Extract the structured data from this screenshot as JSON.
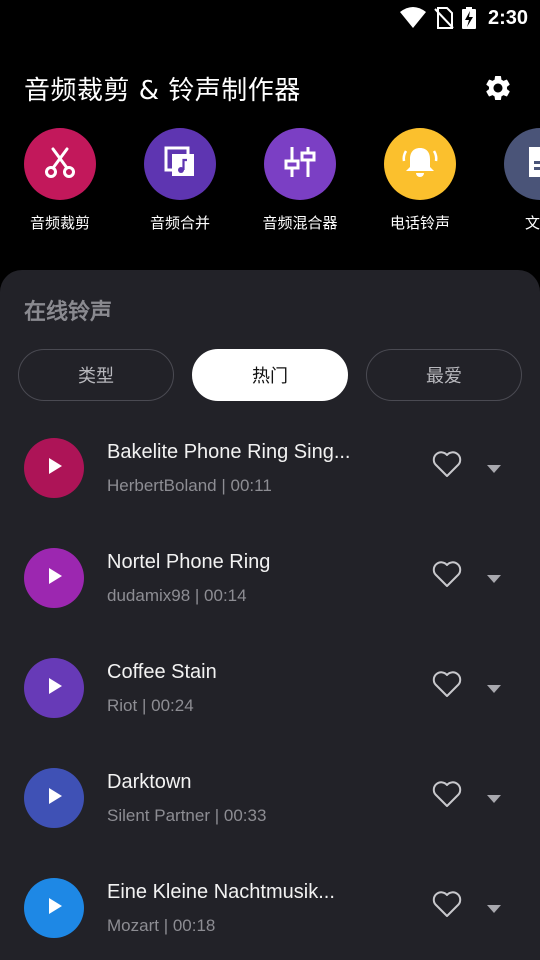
{
  "status_bar": {
    "time": "2:30"
  },
  "header": {
    "title": "音频裁剪 & 铃声制作器"
  },
  "tools": [
    {
      "label": "音频裁剪",
      "color": "#c2185b",
      "icon": "scissors-icon"
    },
    {
      "label": "音频合并",
      "color": "#5e35b1",
      "icon": "merge-icon"
    },
    {
      "label": "音频混合器",
      "color": "#7b3fc4",
      "icon": "mixer-sliders-icon"
    },
    {
      "label": "电话铃声",
      "color": "#fbc02d",
      "icon": "bell-icon"
    },
    {
      "label": "文件",
      "color": "#4a5478",
      "icon": "file-icon"
    }
  ],
  "panel": {
    "title": "在线铃声",
    "tabs": [
      {
        "label": "类型",
        "active": false
      },
      {
        "label": "热门",
        "active": true
      },
      {
        "label": "最爱",
        "active": false
      }
    ]
  },
  "ringtones": [
    {
      "title": "Bakelite Phone Ring Sing...",
      "author": "HerbertBoland",
      "duration": "00:11",
      "color": "#ad1457"
    },
    {
      "title": "Nortel Phone Ring",
      "author": "dudamix98",
      "duration": "00:14",
      "color": "#9c27b0"
    },
    {
      "title": "Coffee Stain",
      "author": "Riot",
      "duration": "00:24",
      "color": "#673ab7"
    },
    {
      "title": "Darktown",
      "author": "Silent Partner",
      "duration": "00:33",
      "color": "#3f51b5"
    },
    {
      "title": "Eine Kleine Nachtmusik...",
      "author": "Mozart",
      "duration": "00:18",
      "color": "#1e88e5"
    }
  ]
}
